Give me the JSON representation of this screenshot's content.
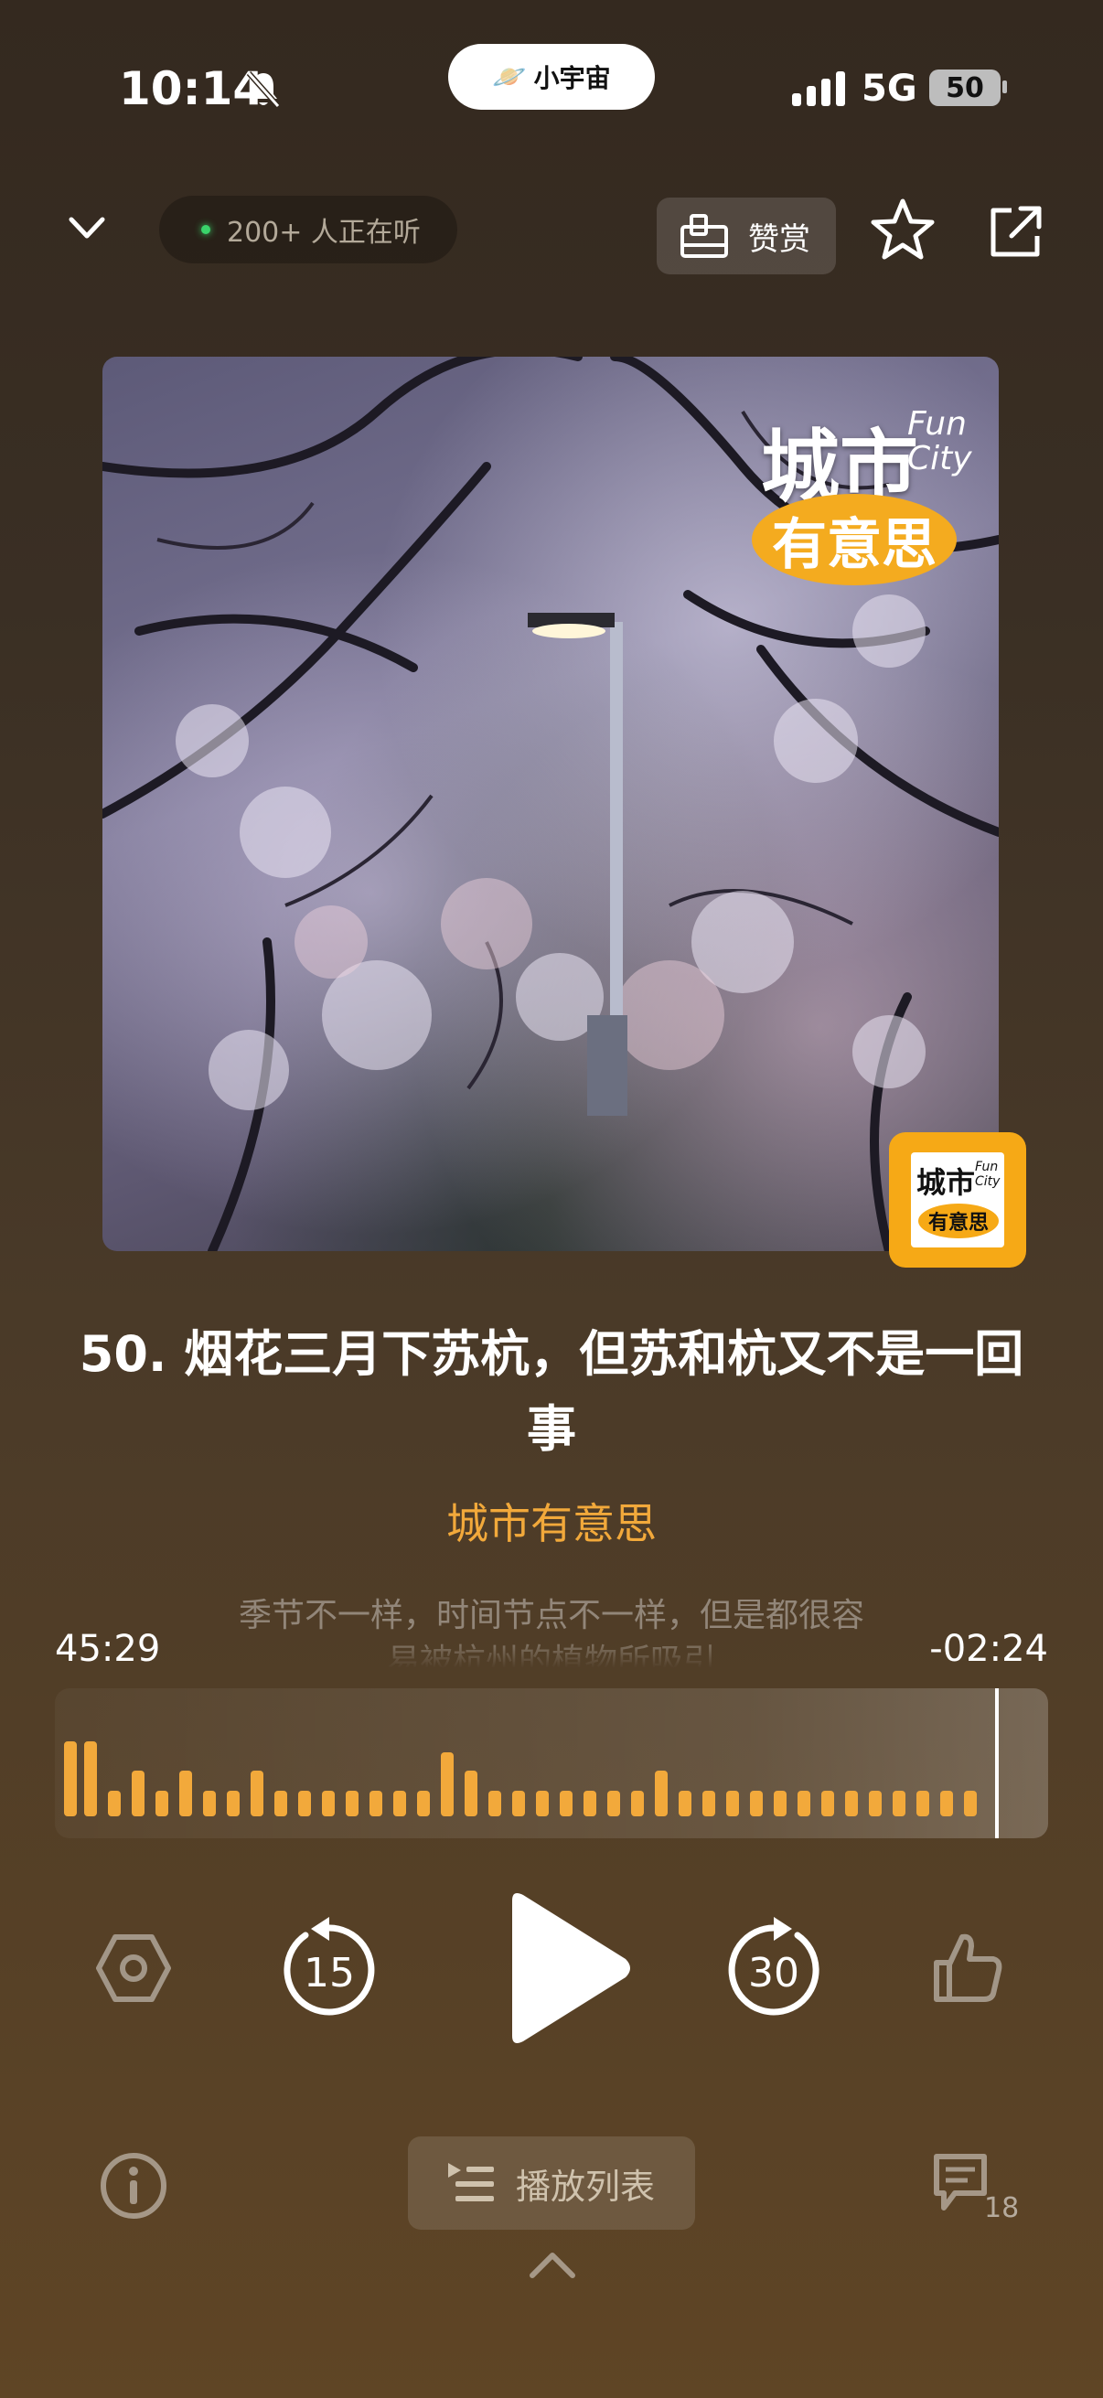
{
  "status_bar": {
    "time": "10:14",
    "app_pill": "小宇宙",
    "network": "5G",
    "battery": "50"
  },
  "header": {
    "listeners": "200+ 人正在听",
    "tip_label": "赞赏"
  },
  "cover": {
    "brand_title": "城市",
    "brand_fun": "Fun",
    "brand_city": "City",
    "brand_subtitle": "有意思"
  },
  "logo_badge": {
    "title": "城市",
    "fun": "Fun",
    "city": "City",
    "subtitle": "有意思"
  },
  "episode": {
    "title": "50. 烟花三月下苏杭，但苏和杭又不是一回事",
    "podcast": "城市有意思",
    "lyric_line1": "季节不一样，时间节点不一样，但是都很容",
    "lyric_line2": "易被杭州的植物所吸引"
  },
  "player": {
    "elapsed": "45:29",
    "remaining": "-02:24",
    "skip_back": "15",
    "skip_forward": "30",
    "progress": 0.95
  },
  "bottom": {
    "playlist_label": "播放列表",
    "comments_count": "18"
  },
  "colors": {
    "accent": "#f2a93b",
    "brand_yellow": "#f6a916"
  }
}
